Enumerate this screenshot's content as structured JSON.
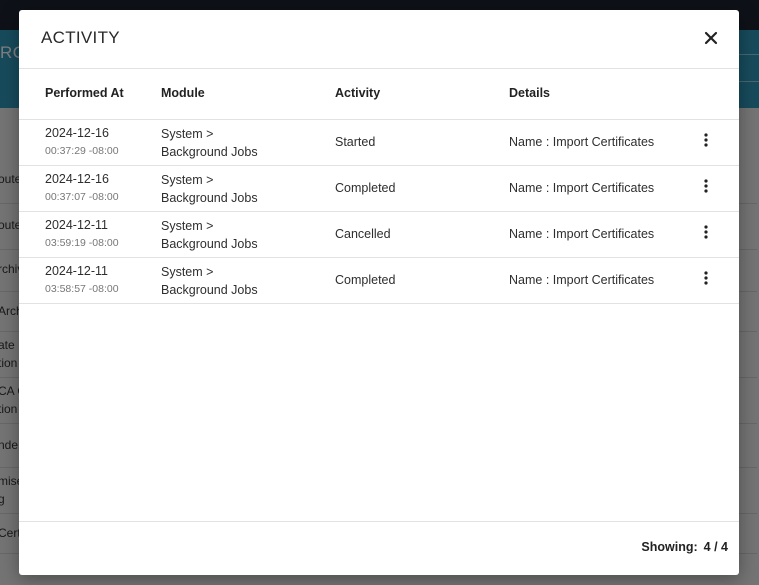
{
  "background": {
    "header_title": "RO",
    "rows": [
      "oute",
      "oute",
      "rchiv",
      "Arch",
      "ate E\ntion",
      "CA C\ntion",
      "nde",
      "mise\ng",
      "Cert"
    ]
  },
  "modal": {
    "title": "ACTIVITY",
    "close_icon": "close-icon",
    "columns": {
      "performed_at": "Performed At",
      "module": "Module",
      "activity": "Activity",
      "details": "Details"
    },
    "rows": [
      {
        "date": "2024-12-16",
        "time": "00:37:29 -08:00",
        "module_line1": "System >",
        "module_line2": "Background Jobs",
        "activity": "Started",
        "details": "Name : Import Certificates"
      },
      {
        "date": "2024-12-16",
        "time": "00:37:07 -08:00",
        "module_line1": "System >",
        "module_line2": "Background Jobs",
        "activity": "Completed",
        "details": "Name : Import Certificates"
      },
      {
        "date": "2024-12-11",
        "time": "03:59:19 -08:00",
        "module_line1": "System >",
        "module_line2": "Background Jobs",
        "activity": "Cancelled",
        "details": "Name : Import Certificates"
      },
      {
        "date": "2024-12-11",
        "time": "03:58:57 -08:00",
        "module_line1": "System >",
        "module_line2": "Background Jobs",
        "activity": "Completed",
        "details": "Name : Import Certificates"
      }
    ],
    "footer": {
      "showing_label": "Showing:",
      "showing_count": "4 / 4"
    }
  }
}
